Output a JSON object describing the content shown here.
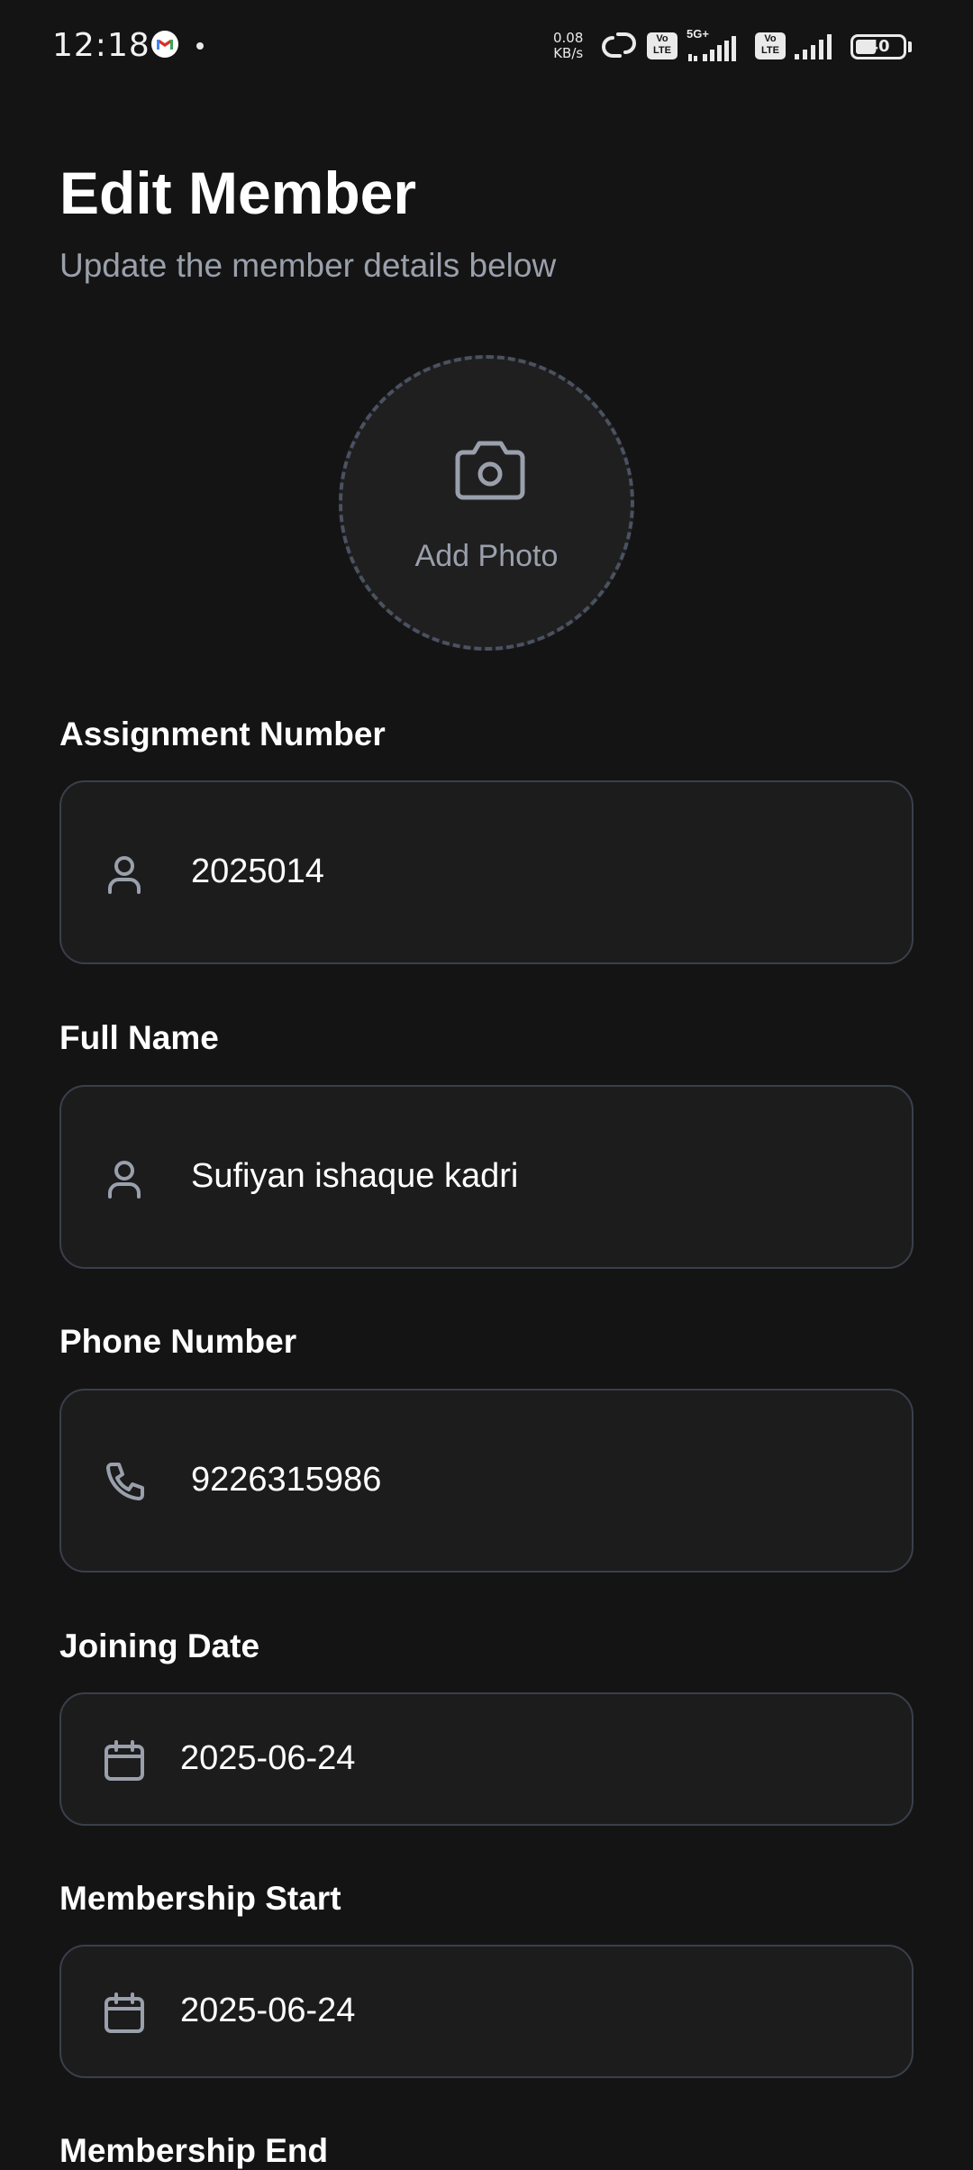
{
  "status_bar": {
    "time": "12:18",
    "network_speed_value": "0.08",
    "network_speed_unit": "KB/s",
    "sim1_badge": "Vo LTE",
    "sim1_network": "5G+",
    "sim2_badge": "Vo LTE",
    "battery": "40",
    "icons": [
      "gmail-icon",
      "notification-dot",
      "hotspot-link-icon",
      "volte-icon",
      "signal-icon",
      "battery-icon"
    ]
  },
  "header": {
    "title": "Edit Member",
    "subtitle": "Update the member details below"
  },
  "photo": {
    "label": "Add Photo",
    "icon": "camera-icon"
  },
  "fields": {
    "assignment_number": {
      "label": "Assignment Number",
      "value": "2025014",
      "icon": "user-icon"
    },
    "full_name": {
      "label": "Full Name",
      "value": "Sufiyan ishaque kadri",
      "icon": "user-icon"
    },
    "phone_number": {
      "label": "Phone Number",
      "value": "9226315986",
      "icon": "phone-icon"
    },
    "joining_date": {
      "label": "Joining Date",
      "value": "2025-06-24",
      "icon": "calendar-icon"
    },
    "membership_start": {
      "label": "Membership Start",
      "value": "2025-06-24",
      "icon": "calendar-icon"
    },
    "membership_end": {
      "label": "Membership End"
    }
  },
  "colors": {
    "background": "#141414",
    "field_background": "#1c1c1d",
    "field_border": "#3a3f4a",
    "muted_text": "#9aa0ab",
    "icon": "#9aa0ab"
  }
}
